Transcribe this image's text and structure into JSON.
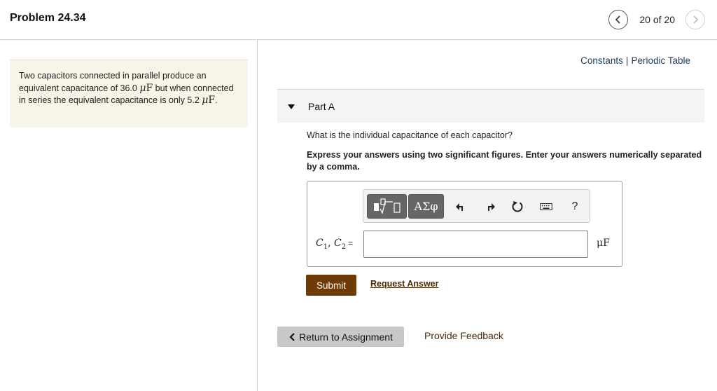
{
  "header": {
    "title": "Problem 24.34",
    "pager_text": "20 of 20"
  },
  "problem": {
    "text_1": "Two capacitors connected in parallel produce an equivalent capacitance of 36.0",
    "unit_mu": "μ",
    "unit_F": "F",
    "text_2": "but when connected in series the equivalent capacitance is only 5.2",
    "text_end": "."
  },
  "links": {
    "constants": "Constants",
    "separator": "|",
    "periodic_table": "Periodic Table"
  },
  "part": {
    "label": "Part A",
    "question": "What is the individual capacitance of each capacitor?",
    "instructions": "Express your answers using two significant figures. Enter your answers numerically separated by a comma."
  },
  "toolbar": {
    "templates_icon": "fraction-sqrt-icon",
    "symbols_label": "ΑΣφ",
    "undo_icon": "undo-icon",
    "redo_icon": "redo-icon",
    "reset_icon": "reset-icon",
    "keyboard_icon": "keyboard-icon",
    "help_label": "?"
  },
  "answer": {
    "var_c": "C",
    "sub_1": "1",
    "comma": ", ",
    "sub_2": "2",
    "equals": "=",
    "value": "",
    "unit": "μF"
  },
  "actions": {
    "submit_label": "Submit",
    "request_answer_label": "Request Answer",
    "return_label": "Return to Assignment",
    "feedback_label": "Provide Feedback"
  },
  "colors": {
    "submit_bg": "#6e3a05",
    "input_border": "#b87914",
    "problem_bg": "#f7f5e8",
    "toolbar_button": "#666666"
  }
}
